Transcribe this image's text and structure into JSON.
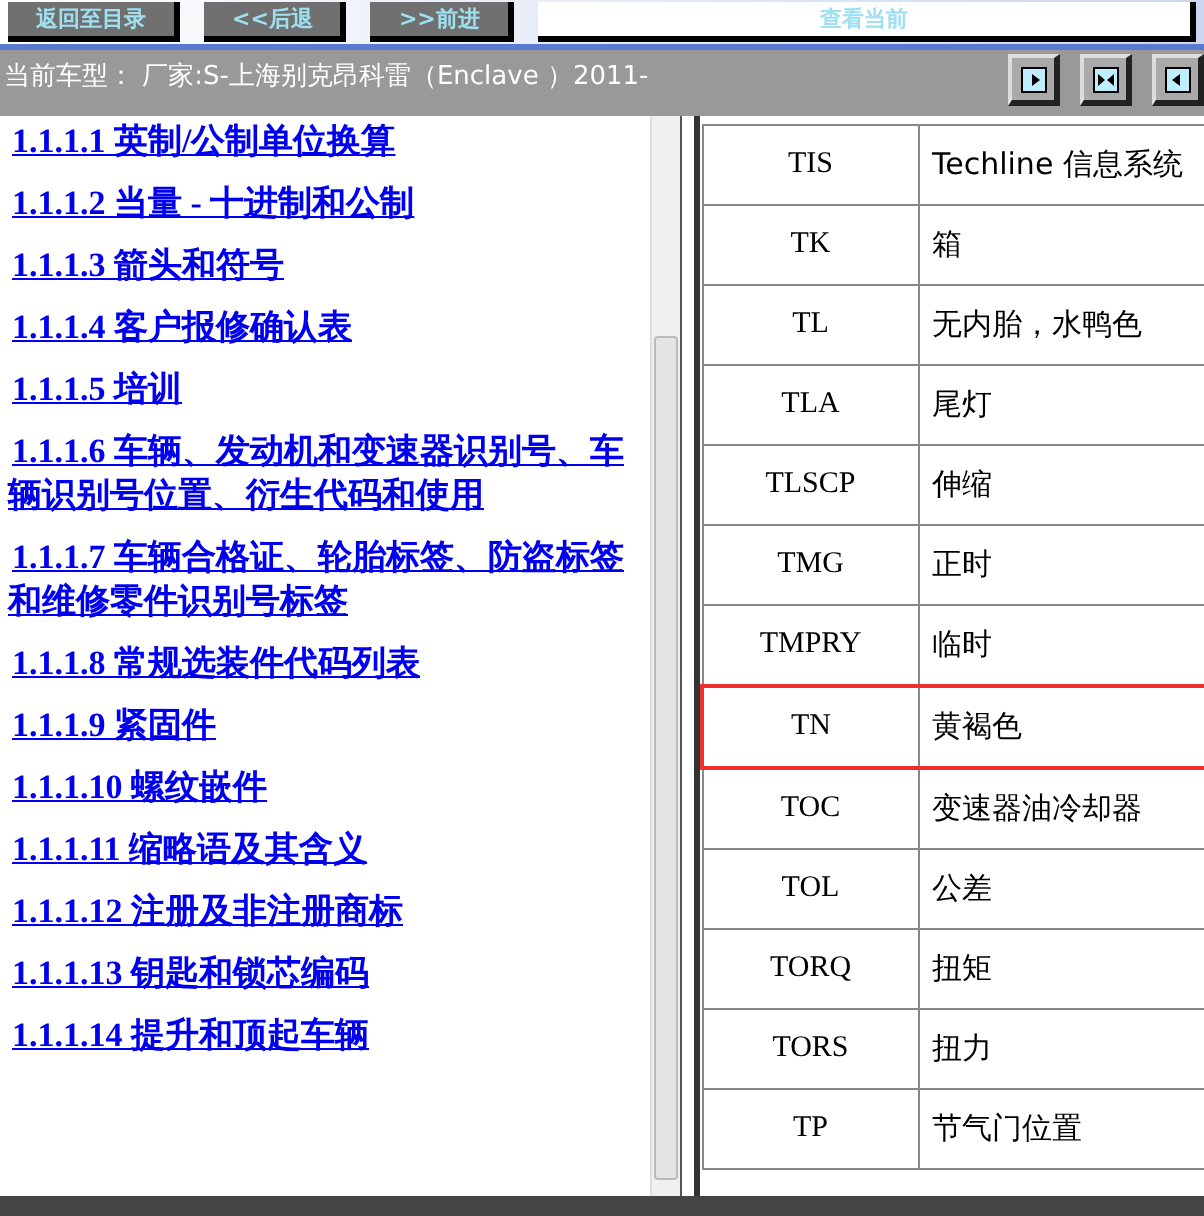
{
  "toolbar": {
    "buttons": [
      "返回至目录",
      "<<后退",
      ">>前进",
      "查看当前"
    ]
  },
  "model_bar": {
    "text": "当前车型： 厂家:S-上海别克昂科雷（Enclave ）2011-"
  },
  "toc": {
    "links": [
      "1.1.1.1 英制/公制单位换算",
      "1.1.1.2 当量 - 十进制和公制",
      "1.1.1.3 箭头和符号",
      "1.1.1.4 客户报修确认表",
      "1.1.1.5 培训",
      "1.1.1.6 车辆、发动机和变速器识别号、车辆识别号位置、衍生代码和使用",
      "1.1.1.7 车辆合格证、轮胎标签、防盗标签和维修零件识别号标签",
      "1.1.1.8 常规选装件代码列表",
      "1.1.1.9 紧固件",
      "1.1.1.10 螺纹嵌件",
      "1.1.1.11 缩略语及其含义",
      "1.1.1.12 注册及非注册商标",
      "1.1.1.13 钥匙和锁芯编码",
      "1.1.1.14 提升和顶起车辆"
    ]
  },
  "abbreviations": {
    "rows": [
      {
        "abbr": "TIS",
        "meaning": "Techline 信息系统",
        "highlighted": false
      },
      {
        "abbr": "TK",
        "meaning": "箱",
        "highlighted": false
      },
      {
        "abbr": "TL",
        "meaning": "无内胎，水鸭色",
        "highlighted": false
      },
      {
        "abbr": "TLA",
        "meaning": "尾灯",
        "highlighted": false
      },
      {
        "abbr": "TLSCP",
        "meaning": "伸缩",
        "highlighted": false
      },
      {
        "abbr": "TMG",
        "meaning": "正时",
        "highlighted": false
      },
      {
        "abbr": "TMPRY",
        "meaning": "临时",
        "highlighted": false
      },
      {
        "abbr": "TN",
        "meaning": "黄褐色",
        "highlighted": true
      },
      {
        "abbr": "TOC",
        "meaning": "变速器油冷却器",
        "highlighted": false
      },
      {
        "abbr": "TOL",
        "meaning": "公差",
        "highlighted": false
      },
      {
        "abbr": "TORQ",
        "meaning": "扭矩",
        "highlighted": false
      },
      {
        "abbr": "TORS",
        "meaning": "扭力",
        "highlighted": false
      },
      {
        "abbr": "TP",
        "meaning": "节气门位置",
        "highlighted": false
      }
    ]
  }
}
